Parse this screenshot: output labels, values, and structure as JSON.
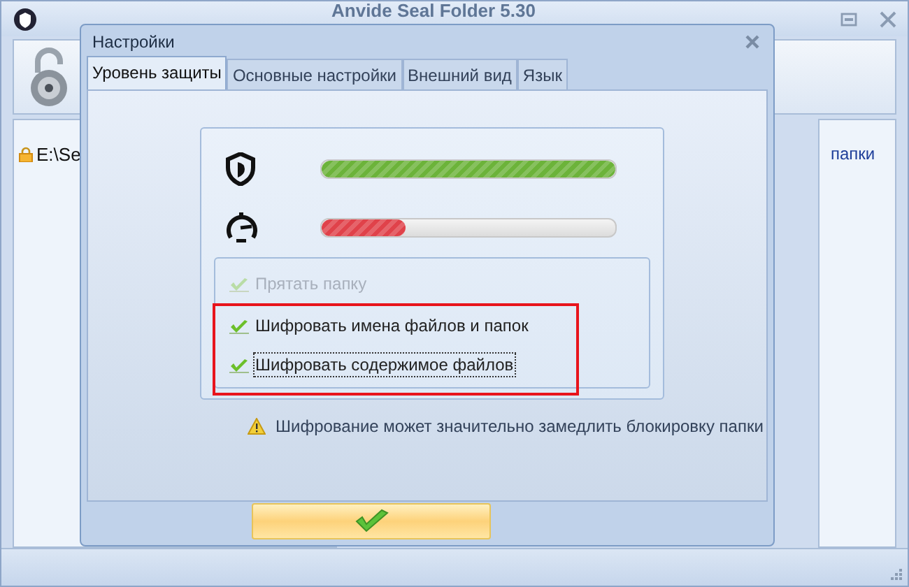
{
  "main_window": {
    "title": "Anvide Seal Folder 5.30",
    "list_items": [
      {
        "label": "E:\\Se",
        "locked": true
      }
    ],
    "column_header": "папки"
  },
  "dialog": {
    "title": "Настройки",
    "tabs": [
      {
        "label": "Уровень защиты",
        "selected": true
      },
      {
        "label": "Основные настройки",
        "selected": false
      },
      {
        "label": "Внешний вид",
        "selected": false
      },
      {
        "label": "Язык",
        "selected": false
      }
    ],
    "meters": [
      {
        "kind": "security",
        "color": "#6cb33a",
        "level": 1.0
      },
      {
        "kind": "speed",
        "color": "#e0424a",
        "level": 0.29
      }
    ],
    "options": [
      {
        "label": "Прятать папку",
        "checked": true,
        "disabled": true,
        "highlighted": false,
        "focused": false
      },
      {
        "label": "Шифровать имена файлов и папок",
        "checked": true,
        "disabled": false,
        "highlighted": true,
        "focused": false
      },
      {
        "label": "Шифровать содержимое файлов",
        "checked": true,
        "disabled": false,
        "highlighted": true,
        "focused": true
      }
    ],
    "warning": "Шифрование может значительно замедлить блокировку папки"
  }
}
